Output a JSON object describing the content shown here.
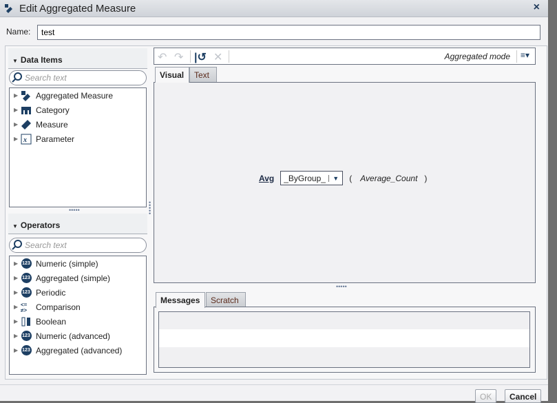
{
  "dialog": {
    "title": "Edit Aggregated Measure",
    "close": "×"
  },
  "name": {
    "label": "Name:",
    "value": "test"
  },
  "data_items": {
    "header": "Data Items",
    "search_placeholder": "Search text",
    "items": [
      "Aggregated Measure",
      "Category",
      "Measure",
      "Parameter"
    ]
  },
  "operators": {
    "header": "Operators",
    "search_placeholder": "Search text",
    "items": [
      "Numeric (simple)",
      "Aggregated (simple)",
      "Periodic",
      "Comparison",
      "Boolean",
      "Numeric (advanced)",
      "Aggregated (advanced)"
    ]
  },
  "toolbar": {
    "mode": "Aggregated mode"
  },
  "editor_tabs": [
    "Visual",
    "Text"
  ],
  "expression": {
    "function": "Avg",
    "group": "_ByGroup_",
    "open": "(",
    "argument": "Average_Count",
    "close": ")"
  },
  "bottom_tabs": [
    "Messages",
    "Scratch"
  ],
  "buttons": {
    "ok": "OK",
    "cancel": "Cancel"
  },
  "colors": {
    "accent": "#1d3f63"
  }
}
